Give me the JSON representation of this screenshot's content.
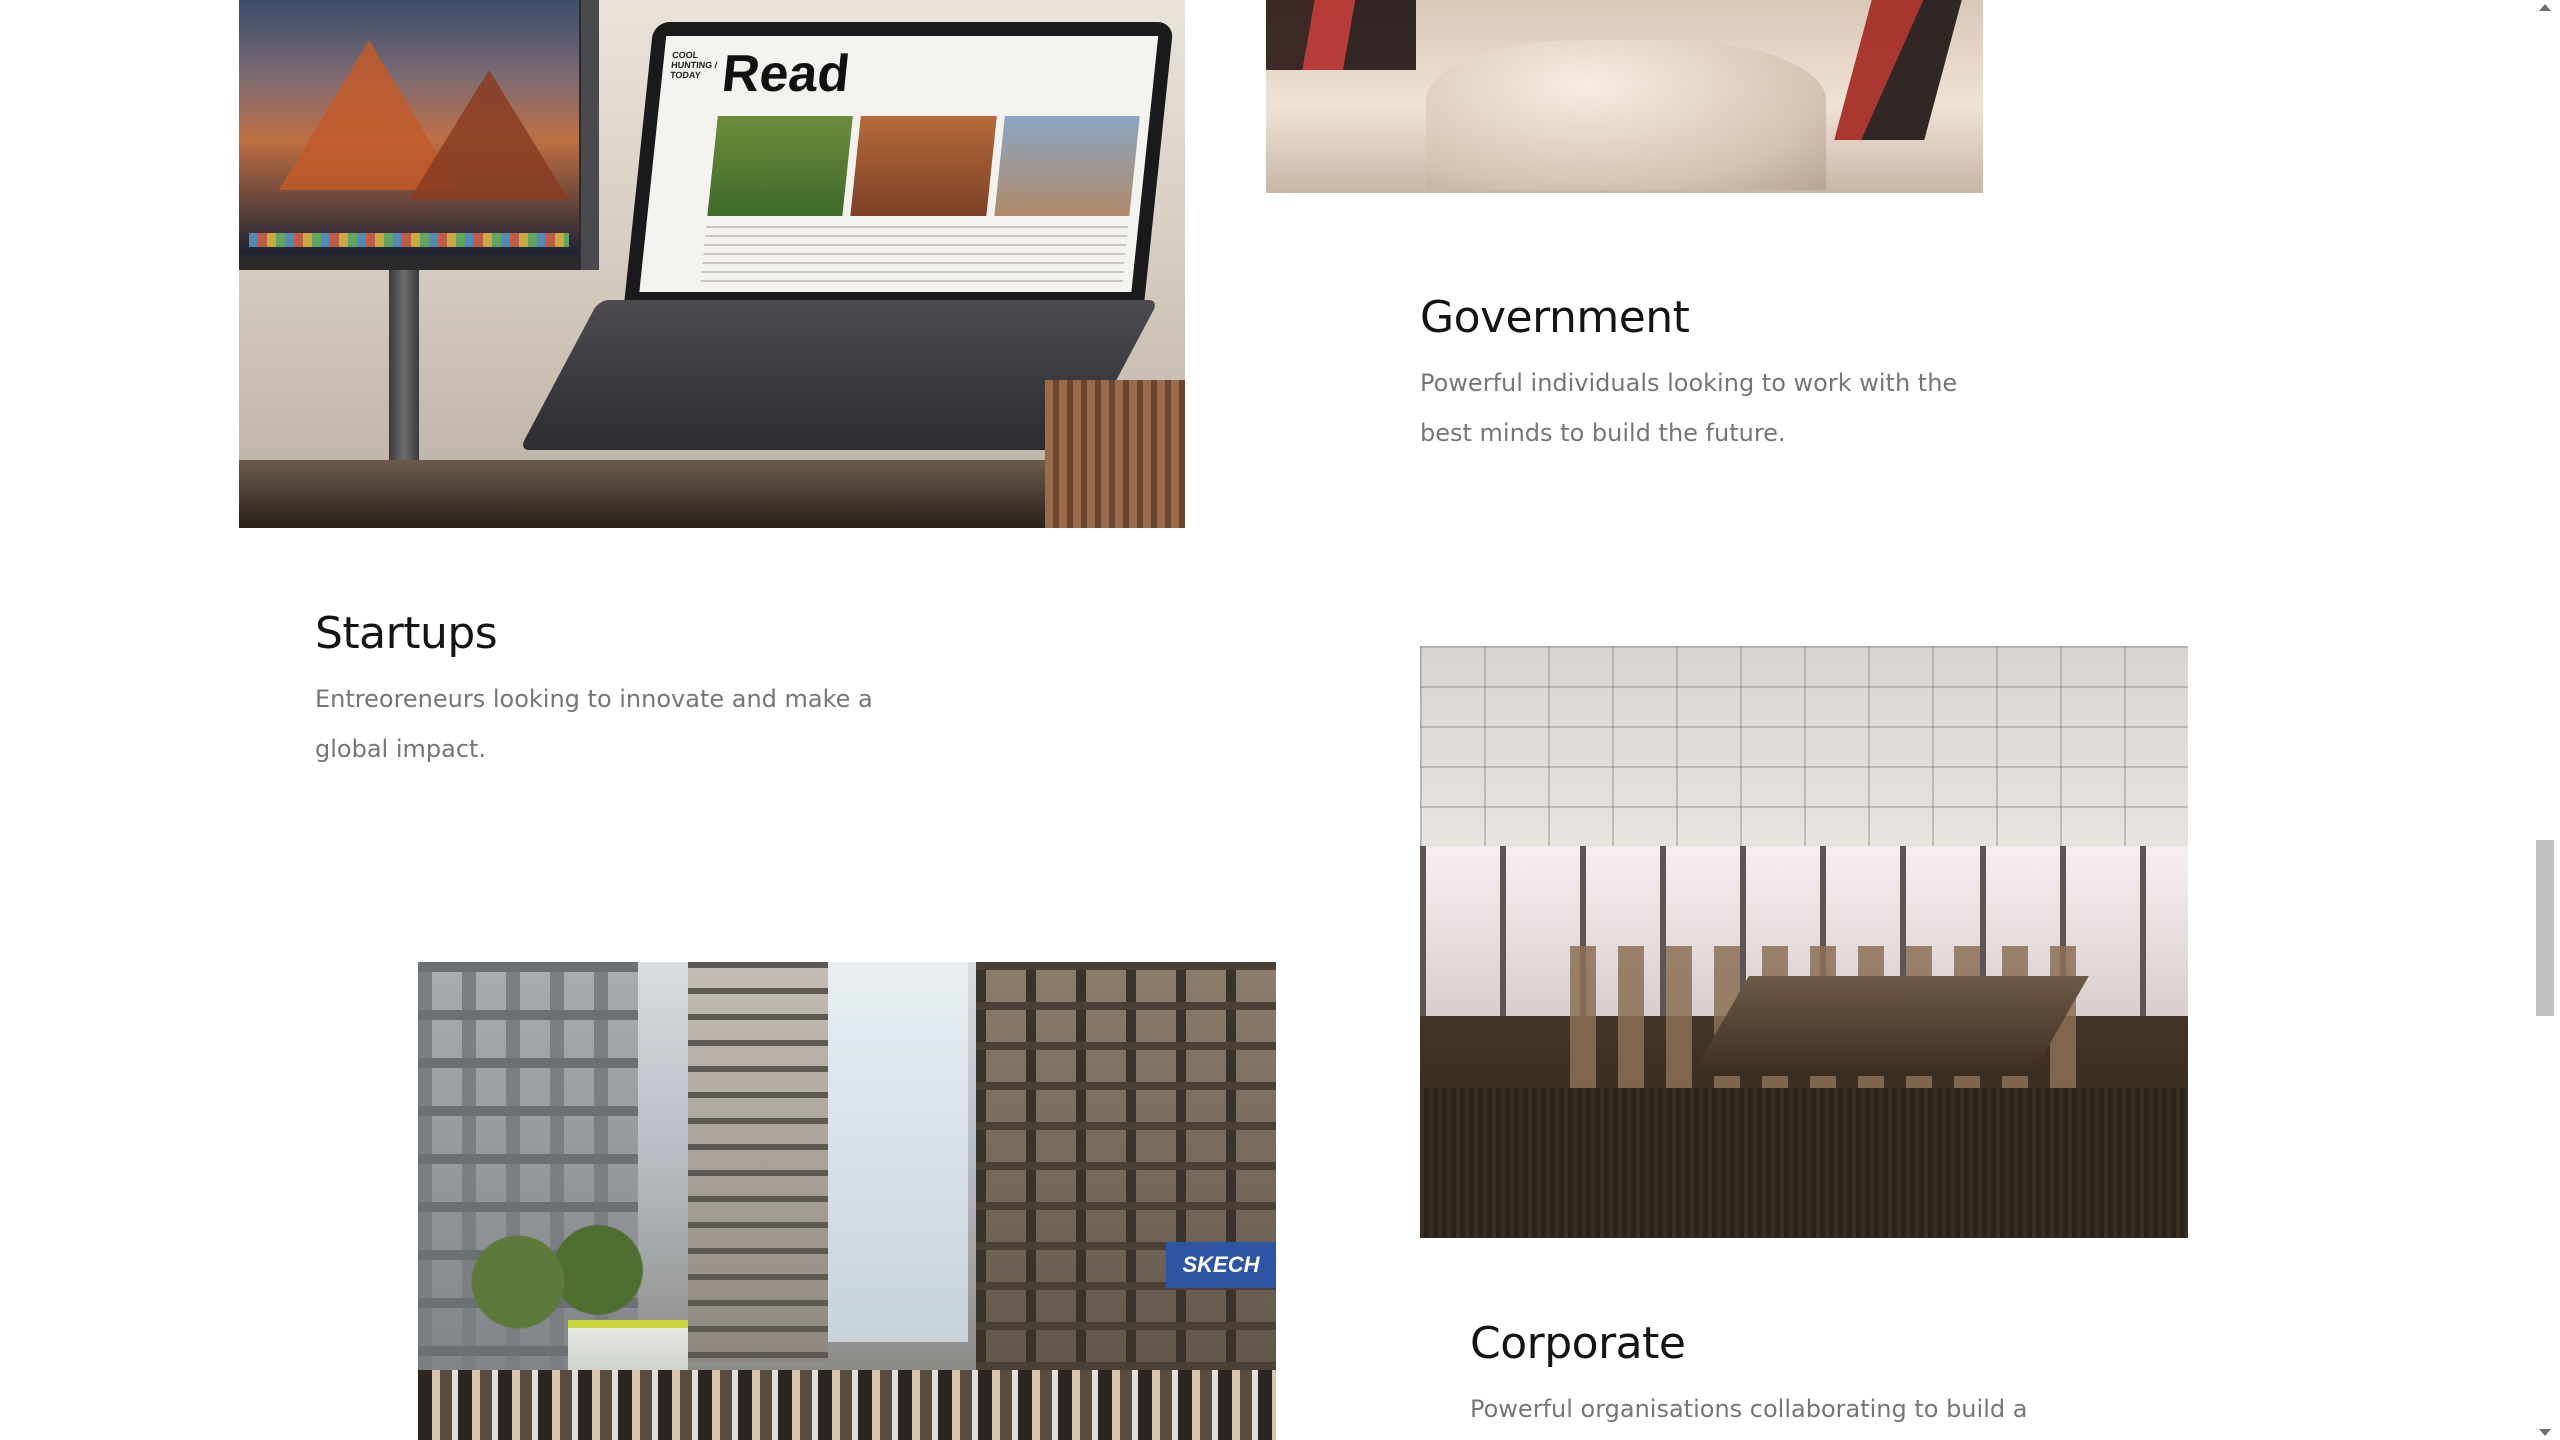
{
  "sections": {
    "government": {
      "title": "Government",
      "description": "Powerful individuals looking to work with the best minds to build the future."
    },
    "startups": {
      "title": "Startups",
      "description": "Entreoreneurs looking to innovate and make a global impact."
    },
    "corporate": {
      "title": "Corporate",
      "description": "Powerful organisations collaborating to build a"
    }
  },
  "images": {
    "laptop_screen_heading": "Read",
    "laptop_sidebar_text": "COOL HUNTING / TODAY",
    "street_sign_text": "SKECH"
  },
  "scrollbar": {
    "position_fraction": 0.62
  }
}
